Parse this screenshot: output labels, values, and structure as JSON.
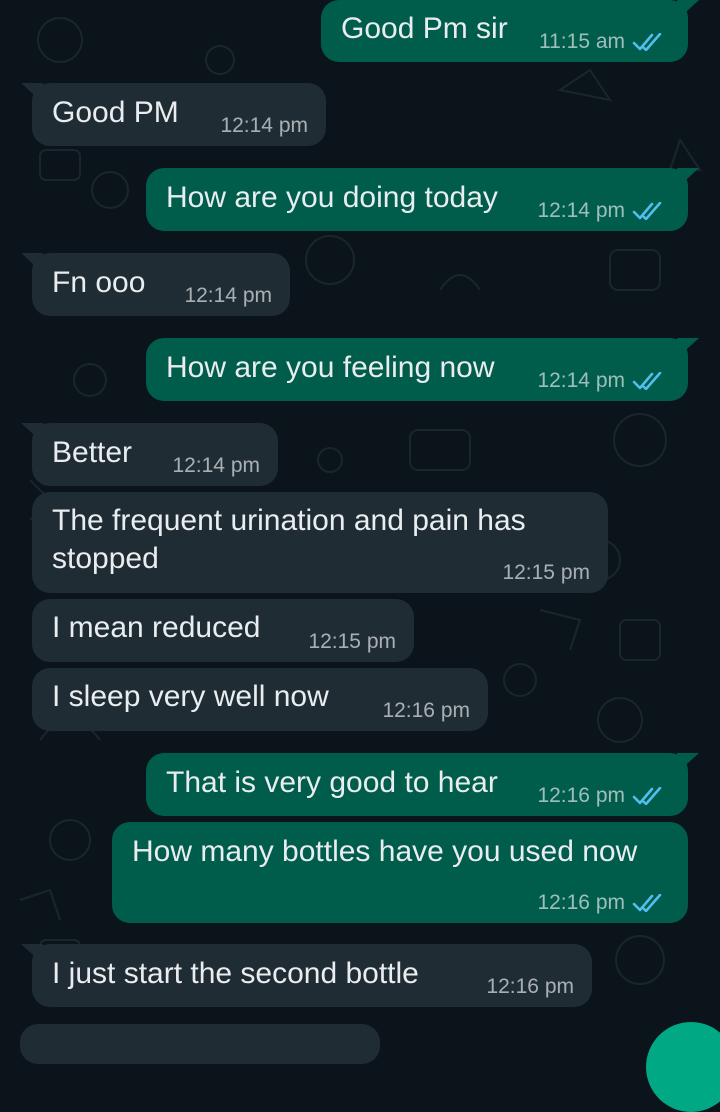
{
  "chat": {
    "messages": [
      {
        "direction": "out",
        "text": "Good Pm sir",
        "time": "11:15 am",
        "status": "read"
      },
      {
        "direction": "in",
        "text": "Good PM",
        "time": "12:14 pm"
      },
      {
        "direction": "out",
        "text": "How are you doing today",
        "time": "12:14 pm",
        "status": "read"
      },
      {
        "direction": "in",
        "text": "Fn ooo",
        "time": "12:14 pm"
      },
      {
        "direction": "out",
        "text": "How are you feeling now",
        "time": "12:14 pm",
        "status": "read"
      },
      {
        "direction": "in",
        "text": "Better",
        "time": "12:14 pm"
      },
      {
        "direction": "in",
        "text": "The frequent urination and pain has stopped",
        "time": "12:15 pm"
      },
      {
        "direction": "in",
        "text": "I mean reduced",
        "time": "12:15 pm"
      },
      {
        "direction": "in",
        "text": "I sleep very well now",
        "time": "12:16 pm"
      },
      {
        "direction": "out",
        "text": "That is very good to hear",
        "time": "12:16 pm",
        "status": "read"
      },
      {
        "direction": "out",
        "text": "How many bottles have you used now",
        "time": "12:16 pm",
        "status": "read"
      },
      {
        "direction": "in",
        "text": "I just start the second bottle",
        "time": "12:16 pm"
      }
    ]
  },
  "colors": {
    "background": "#0b141a",
    "incoming_bubble": "#202c33",
    "outgoing_bubble": "#005c4b",
    "read_ticks": "#53bdeb",
    "fab": "#00a884"
  },
  "icons": {
    "read_receipt": "double-check-icon"
  }
}
